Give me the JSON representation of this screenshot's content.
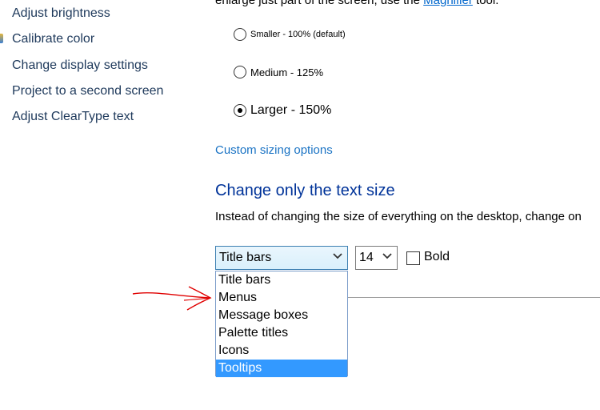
{
  "sidebar": {
    "items": [
      {
        "label": "Adjust brightness"
      },
      {
        "label": "Calibrate color"
      },
      {
        "label": "Change display settings"
      },
      {
        "label": "Project to a second screen"
      },
      {
        "label": "Adjust ClearType text"
      }
    ]
  },
  "intro": {
    "text_before": "enlarge just part of the screen, use the ",
    "link": "Magnifier",
    "text_after": " tool."
  },
  "size_options": [
    {
      "label": "Smaller - 100% (default)",
      "checked": false
    },
    {
      "label": "Medium - 125%",
      "checked": false
    },
    {
      "label": "Larger - 150%",
      "checked": true
    }
  ],
  "custom_sizing_link": "Custom sizing options",
  "text_size_section": {
    "title": "Change only the text size",
    "description": "Instead of changing the size of everything on the desktop, change on"
  },
  "item_select": {
    "value": "Title bars",
    "options": [
      "Title bars",
      "Menus",
      "Message boxes",
      "Palette titles",
      "Icons",
      "Tooltips"
    ],
    "highlighted": "Tooltips"
  },
  "size_select": {
    "value": "14"
  },
  "bold": {
    "label": "Bold",
    "checked": false
  },
  "colors": {
    "link": "#1a73c4",
    "title": "#003399",
    "highlight": "#3399ff",
    "annotation": "#e00000"
  }
}
